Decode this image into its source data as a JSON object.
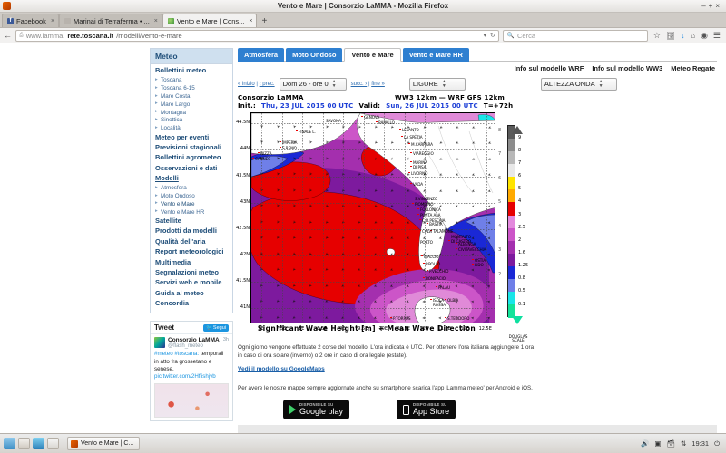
{
  "window": {
    "title": "Vento e Mare | Consorzio LaMMA - Mozilla Firefox",
    "minimize": "–",
    "maximize": "+",
    "close": "×"
  },
  "tabs": [
    {
      "label": "Facebook",
      "favicon": "facebook-icon",
      "close": "×"
    },
    {
      "label": "Marinai di Terraferma • ...",
      "favicon": "generic-page-icon",
      "close": "×"
    },
    {
      "label": "Vento e Mare | Cons...",
      "favicon": "lamma-icon",
      "close": "×"
    }
  ],
  "newtab_label": "+",
  "navbar": {
    "back_icon": "back-arrow-icon",
    "url_prefix": "www.lamma.",
    "url_domain": "rete.toscana.it",
    "url_path": "/modelli/vento-e-mare",
    "url_dropdown": "▾",
    "reload_icon": "reload-icon",
    "search_placeholder": "Cerca",
    "icons": [
      "bookmark-star-icon",
      "reader-icon",
      "download-icon",
      "home-icon",
      "pocket-icon",
      "menu-icon"
    ]
  },
  "sidebar": {
    "heading": "Meteo",
    "items": [
      {
        "label": "Bollettini meteo",
        "level": 1
      },
      {
        "label": "Toscana",
        "level": 2
      },
      {
        "label": "Toscana 6-15",
        "level": 2
      },
      {
        "label": "Mare Costa",
        "level": 2
      },
      {
        "label": "Mare Largo",
        "level": 2
      },
      {
        "label": "Montagna",
        "level": 2
      },
      {
        "label": "Sinottica",
        "level": 2
      },
      {
        "label": "Località",
        "level": 2
      },
      {
        "label": "Meteo per eventi",
        "level": 1
      },
      {
        "label": "Previsioni stagionali",
        "level": 1
      },
      {
        "label": "Bollettini agrometeo",
        "level": 1
      },
      {
        "label": "Osservazioni e dati",
        "level": 1
      },
      {
        "label": "Modelli",
        "level": 1,
        "current": true
      },
      {
        "label": "Atmosfera",
        "level": 2
      },
      {
        "label": "Moto Ondoso",
        "level": 2
      },
      {
        "label": "Vento e Mare",
        "level": 2,
        "current": true
      },
      {
        "label": "Vento e Mare HR",
        "level": 2
      },
      {
        "label": "Satellite",
        "level": 1
      },
      {
        "label": "Prodotti da modelli",
        "level": 1
      },
      {
        "label": "Qualità dell'aria",
        "level": 1
      },
      {
        "label": "Report meteorologici",
        "level": 1
      },
      {
        "label": "Multimedia",
        "level": 1
      },
      {
        "label": "Segnalazioni meteo",
        "level": 1
      },
      {
        "label": "Servizi web e mobile",
        "level": 1
      },
      {
        "label": "Guida al meteo",
        "level": 1
      },
      {
        "label": "Concordia",
        "level": 1
      }
    ]
  },
  "twitter": {
    "title": "Tweet",
    "follow_label": "Segui",
    "account_name": "Consorzio LaMMA",
    "handle": "@flash_meteo",
    "age": "3h",
    "text_tags": "#meteo #toscana:",
    "text_body": "temporali in atto fra grossetano e senese.",
    "link": "pic.twitter.com/2Hflishjvb"
  },
  "model_tabs": [
    {
      "label": "Atmosfera",
      "selected": false
    },
    {
      "label": "Moto Ondoso",
      "selected": false
    },
    {
      "label": "Vento e Mare",
      "selected": true
    },
    {
      "label": "Vento e Mare HR",
      "selected": false
    }
  ],
  "info_links": [
    "Info sul modello WRF",
    "Info sul modello WW3",
    "Meteo Regate"
  ],
  "controls": {
    "nav_first": "« inizio",
    "nav_prev": "‹ prec.",
    "nav_next": "succ. ›",
    "nav_last": "fine »",
    "date_value": "Dom 26 - ore 0",
    "area_value": "LIGURE",
    "param_value": "ALTEZZA ONDA"
  },
  "figure": {
    "org": "Consorzio LaMMA",
    "model": "WW3 12km  —  WRF GFS 12km",
    "init_label": "Init.:",
    "init_value": "Thu, 23 JUL 2015   00 UTC",
    "valid_label": "Valid:",
    "valid_value": "Sun, 26 JUL 2015   00 UTC",
    "lead_value": "T=+72h",
    "caption": "Significant Wave Height [m] + Mean Wave Direction",
    "colorbar_title": "DOUGLAS SCALE"
  },
  "chart_data": {
    "type": "heatmap",
    "title": "Significant Wave Height [m] + Mean Wave Direction",
    "xlabel": "Longitude",
    "ylabel": "Latitude",
    "xlim": [
      6.75,
      12.75
    ],
    "ylim": [
      40.7,
      44.7
    ],
    "grid": true,
    "xtick_labels": [
      "7E",
      "7.5E",
      "8E",
      "8.5E",
      "9E",
      "9.5E",
      "10E",
      "10.5E",
      "11E",
      "11.5E",
      "12E",
      "12.5E"
    ],
    "ytick_labels": [
      "44.5N",
      "44N",
      "43.5N",
      "43N",
      "42.5N",
      "42N",
      "41.5N",
      "41N"
    ],
    "colorbar": {
      "title": "DOUGLAS SCALE",
      "unit": "m",
      "levels": [
        0.1,
        0.5,
        0.8,
        1.25,
        1.6,
        2,
        2.5,
        3,
        4,
        5,
        6,
        7,
        8,
        9
      ],
      "colors": [
        "#13e39a",
        "#19e5e8",
        "#6f7fe8",
        "#1a28d6",
        "#7d1a9e",
        "#a42fae",
        "#cc55c8",
        "#e389dd",
        "#e60000",
        "#ffaa00",
        "#ffe400",
        "#e8e8e8",
        "#b8b8b8",
        "#8c8c8c",
        "#5a5a5a"
      ],
      "douglas_labels": [
        "1",
        "2",
        "3",
        "4",
        "5",
        "6",
        "7",
        "8"
      ]
    },
    "cities": [
      "SAVONA",
      "GENOVA",
      "RAPALLO",
      "LEVANTO",
      "LA SPEZIA",
      "M.CARRARA",
      "VIAREGGIO",
      "MARINA DI PISA",
      "LIVORNO",
      "VADA",
      "S.VINCENZO",
      "PIOMBINO",
      "FOLLONICA",
      "PUNTA ALA",
      "C.D.PESCAIA",
      "TALAMONE",
      "MONTALTO DI CASTRO",
      "CIVITAVECCHIA",
      "OSTIA LIDO",
      "FINALE L.",
      "IMPERIA",
      "S.REMO",
      "NIZZA",
      "CANNES",
      "BASTIA",
      "CALVI",
      "PORTO",
      "AJACCIO",
      "P.POLLO",
      "P.VECCHIO",
      "BONIFACIO",
      "PALAU",
      "ISOLA ROSSA",
      "ALGHERO",
      "OLBIA",
      "P.TORRES",
      "S.TEODORO",
      "ALBENGA"
    ],
    "notes": "Purple/magenta shading over Ligurian and Tyrrhenian sea with red core (3-4 m) off Corsica and Tuscany coast"
  },
  "body_text": {
    "note": "Ogni giorno vengono effettuate 2 corse del modello. L'ora indicata è UTC. Per ottenere l'ora italiana aggiungere 1 ora in caso di ora solare (inverno) o 2 ore in caso di ora legale (estate).",
    "gmaps_link": "Vedi il modello su GoogleMaps",
    "app_note": "Per avere le nostre mappe sempre aggiornate anche su smartphone scarica l'app 'Lamma meteo' per Android e iOS."
  },
  "stores": {
    "google_sub": "DISPONIBILE SU",
    "google_big": "Google play",
    "apple_sub": "Disponibile su",
    "apple_big": "App Store"
  },
  "taskbar": {
    "window_label": "Vento e Mare | C...",
    "clock": "19:31",
    "tray": [
      "volume-icon",
      "display-icon",
      "archive-icon",
      "network-icon",
      "power-icon"
    ]
  }
}
